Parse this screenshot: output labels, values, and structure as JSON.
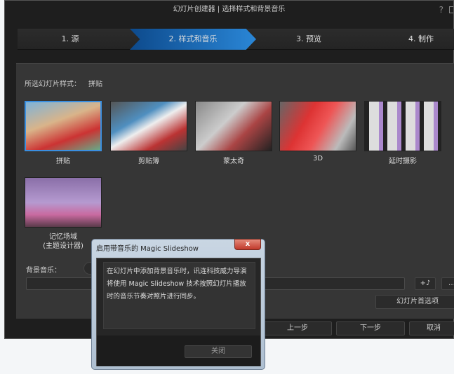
{
  "window": {
    "title": "幻灯片创建器 | 选择样式和背景音乐",
    "help": "?"
  },
  "steps": [
    {
      "label": "1. 源"
    },
    {
      "label": "2. 样式和音乐"
    },
    {
      "label": "3. 预览"
    },
    {
      "label": "4. 制作"
    }
  ],
  "style": {
    "label": "所选幻灯片样式：",
    "value": "拼贴"
  },
  "thumbs": [
    {
      "label": "拼贴"
    },
    {
      "label": "剪贴簿"
    },
    {
      "label": "蒙太奇"
    },
    {
      "label": "3D"
    },
    {
      "label": "延时摄影"
    },
    {
      "label": "记忆场域",
      "sub": "(主题设计器)"
    }
  ],
  "music": {
    "label": "背景音乐：",
    "add": "+♪",
    "more": "…",
    "prefs": "幻灯片首选项"
  },
  "nav": {
    "prev": "上一步",
    "next": "下一步",
    "cancel": "取消"
  },
  "dialog": {
    "title": "启用带音乐的 Magic Slideshow",
    "close_x": "x",
    "text": "在幻灯片中添加背景音乐时，讯连科技威力导演将使用 Magic Slideshow 技术按照幻灯片播放时的音乐节奏对照片进行同步。",
    "close": "关闭"
  }
}
